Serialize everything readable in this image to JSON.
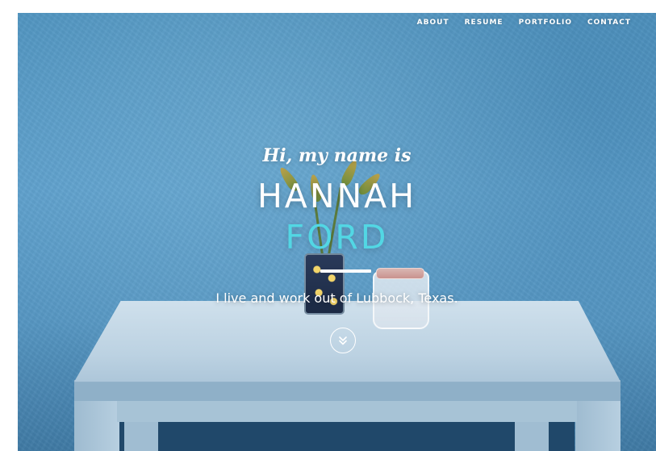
{
  "nav": {
    "items": [
      {
        "label": "ABOUT"
      },
      {
        "label": "RESUME"
      },
      {
        "label": "PORTFOLIO"
      },
      {
        "label": "CONTACT"
      }
    ]
  },
  "hero": {
    "greeting": "Hi, my name is",
    "first_name": "HANNAH",
    "last_name": "FORD",
    "tagline": "I live and work out of Lubbock, Texas.",
    "scroll_icon": "double-chevron-down-icon"
  },
  "colors": {
    "accent": "#52d7e4",
    "text": "#ffffff",
    "wall": "#5c9ecb"
  }
}
